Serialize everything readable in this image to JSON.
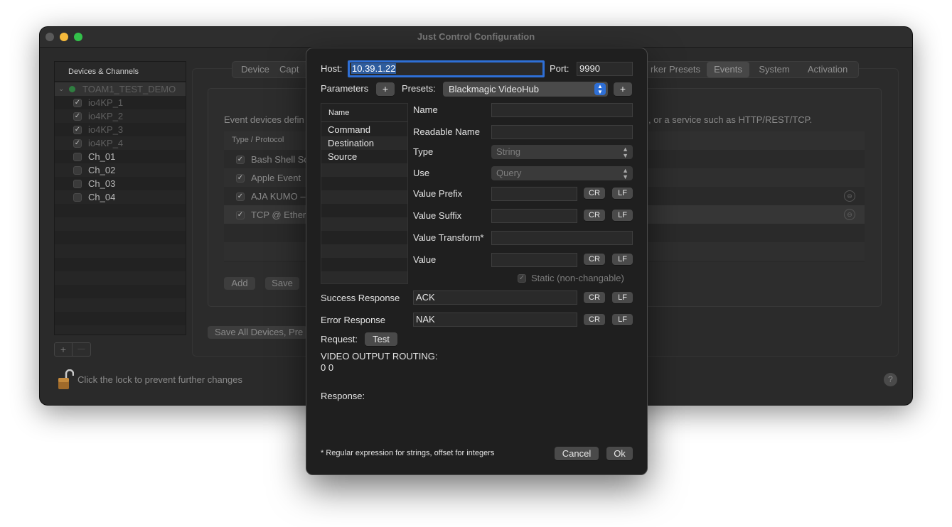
{
  "main_window": {
    "title": "Just Control Configuration",
    "sidebar": {
      "header": "Devices & Channels",
      "device": "TOAM1_TEST_DEMO",
      "items": [
        "io4KP_1",
        "io4KP_2",
        "io4KP_3",
        "io4KP_4",
        "Ch_01",
        "Ch_02",
        "Ch_03",
        "Ch_04"
      ],
      "add_label": "+",
      "remove_label": "—"
    },
    "tabs": [
      "Device",
      "Capt",
      "rker Presets",
      "Events",
      "System",
      "Activation"
    ],
    "description": "Event devices defin",
    "description_tail": ", or a service such as HTTP/REST/TCP.",
    "table_header": "Type / Protocol",
    "rows": [
      "Bash Shell Sc",
      "Apple Event",
      "AJA KUMO –",
      "TCP @ Ether"
    ],
    "add_label": "Add",
    "save_label": "Save",
    "save_all_label": "Save All Devices, Pre",
    "lock_text": "Click the lock to prevent further changes",
    "help_label": "?"
  },
  "dialog": {
    "host_label": "Host:",
    "host_value": "10.39.1.22",
    "port_label": "Port:",
    "port_value": "9990",
    "parameters_label": "Parameters",
    "presets_label": "Presets:",
    "preset_value": "Blackmagic VideoHub",
    "plus": "+",
    "param_list_header": "Name",
    "param_list": [
      "Command",
      "Destination",
      "Source"
    ],
    "fields": {
      "name_label": "Name",
      "readable_name_label": "Readable Name",
      "type_label": "Type",
      "type_value": "String",
      "use_label": "Use",
      "use_value": "Query",
      "value_prefix_label": "Value Prefix",
      "value_suffix_label": "Value Suffix",
      "value_transform_label": "Value Transform*",
      "value_label": "Value",
      "static_label": "Static (non-changable)"
    },
    "cr": "CR",
    "lf": "LF",
    "success_label": "Success Response",
    "success_value": "ACK",
    "error_label": "Error Response",
    "error_value": "NAK",
    "request_label": "Request:",
    "test_label": "Test",
    "request_text_line1": "VIDEO OUTPUT ROUTING:",
    "request_text_line2": "0 0",
    "response_label": "Response:",
    "footnote": "* Regular expression for strings, offset for integers",
    "cancel_label": "Cancel",
    "ok_label": "Ok"
  },
  "colors": {
    "accent": "#2e6fd6",
    "close": "#5a5a5a",
    "minimize": "#f5b93b",
    "zoom": "#33c04a",
    "status_dot": "#2db14a"
  }
}
